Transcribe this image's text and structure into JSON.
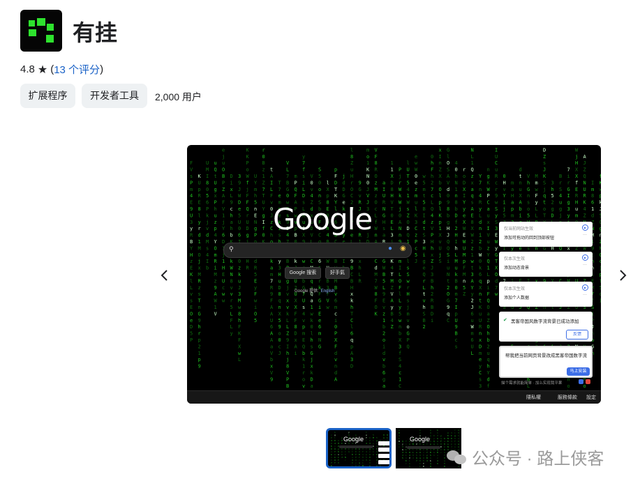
{
  "app": {
    "title": "有挂",
    "icon": "app-logo-icon",
    "accent_color": "#2ee32e"
  },
  "rating": {
    "score": "4.8",
    "star": "★",
    "reviews_open": "(",
    "reviews_link": "13 个评分",
    "reviews_close": ")"
  },
  "chips": [
    "扩展程序",
    "开发者工具"
  ],
  "users": "2,000 用户",
  "carousel": {
    "prev_icon": "‹",
    "next_icon": "›",
    "screenshot": {
      "google_logo": "Google",
      "search_placeholder": "",
      "buttons": [
        "Google 搜索",
        "好手氣"
      ],
      "language_prefix": "Google 提供:",
      "language_link": "English",
      "footer_links": [
        "隱私權",
        "服務條款",
        "設定"
      ],
      "cards": [
        {
          "scope": "仅当前网站生效",
          "title": "添加可拖动的回到顶部按钮"
        },
        {
          "scope": "仅本次生效",
          "title": "添加动态背景"
        },
        {
          "scope": "仅本次生效",
          "title": "添加个人数据"
        }
      ],
      "success_message": "黑客帝国风数字流背景已成功添加",
      "feedback_button": "反馈",
      "request_text": "帮我把当前网页背景改成黑客帝国数字流",
      "install_button": "马上安装",
      "hint_text": "描个需求就能简单 · 加么实现我平果"
    },
    "thumbnails": [
      {
        "logo": "Google",
        "selected": true
      },
      {
        "logo": "Google",
        "selected": false
      }
    ]
  },
  "watermark": {
    "text": "公众号 · 路上侠客"
  }
}
